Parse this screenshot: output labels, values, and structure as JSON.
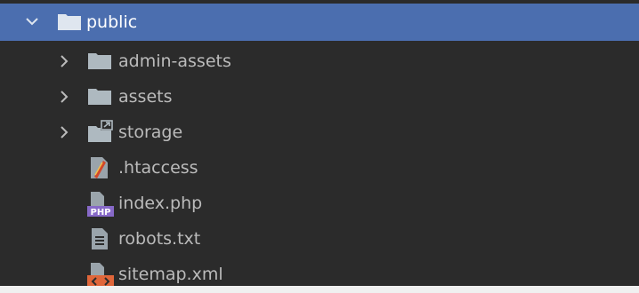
{
  "tree": {
    "root": {
      "label": "public",
      "expanded": true,
      "icon": "folder-icon"
    },
    "children": [
      {
        "label": "admin-assets",
        "type": "folder",
        "icon": "folder-icon",
        "expanded": false
      },
      {
        "label": "assets",
        "type": "folder",
        "icon": "folder-icon",
        "expanded": false
      },
      {
        "label": "storage",
        "type": "symlink-folder",
        "icon": "symlink-folder-icon",
        "expanded": false
      },
      {
        "label": ".htaccess",
        "type": "file",
        "icon": "htaccess-file-icon"
      },
      {
        "label": "index.php",
        "type": "file",
        "icon": "php-file-icon"
      },
      {
        "label": "robots.txt",
        "type": "file",
        "icon": "text-file-icon"
      },
      {
        "label": "sitemap.xml",
        "type": "file",
        "icon": "xml-file-icon"
      }
    ]
  },
  "colors": {
    "background": "#2b2b2b",
    "selection": "#4b6eaf",
    "text": "#bbbbbb",
    "folder": "#aeb9c0",
    "php_badge": "#8769c8",
    "xml_badge": "#e0663a"
  }
}
